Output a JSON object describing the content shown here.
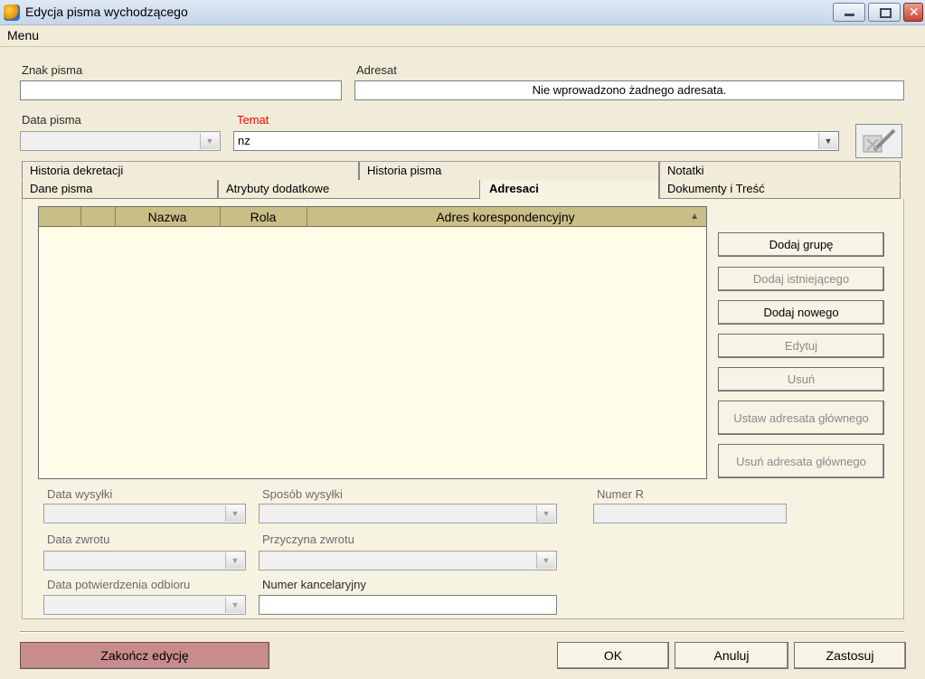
{
  "window": {
    "title": "Edycja pisma wychodzącego"
  },
  "menu": {
    "items": [
      "Menu"
    ]
  },
  "header": {
    "znak_label": "Znak pisma",
    "znak_value": "",
    "adresat_label": "Adresat",
    "adresat_value": "Nie wprowadzono żadnego adresata.",
    "data_label": "Data pisma",
    "data_value": "",
    "temat_label": "Temat",
    "temat_value": "nz"
  },
  "tabs": {
    "row1": [
      "Historia dekretacji",
      "Historia pisma",
      "Notatki"
    ],
    "row2": [
      "Dane pisma",
      "Atrybuty dodatkowe",
      "Adresaci",
      "Dokumenty i Treść"
    ],
    "active": "Adresaci"
  },
  "grid": {
    "columns": [
      "",
      "",
      "Nazwa",
      "Rola",
      "Adres korespondencyjny"
    ],
    "rows": []
  },
  "side_buttons": [
    {
      "label": "Dodaj grupę",
      "enabled": true
    },
    {
      "label": "Dodaj istniejącego",
      "enabled": false
    },
    {
      "label": "Dodaj nowego",
      "enabled": true
    },
    {
      "label": "Edytuj",
      "enabled": false
    },
    {
      "label": "Usuń",
      "enabled": false
    },
    {
      "label": "Ustaw adresata głównego",
      "enabled": false
    },
    {
      "label": "Usuń adresata głównego",
      "enabled": true
    }
  ],
  "fields": {
    "data_wysylki": "Data wysyłki",
    "sposob_wysylki": "Sposób wysyłki",
    "numer_r": "Numer R",
    "data_zwrotu": "Data zwrotu",
    "przyczyna_zwrotu": "Przyczyna zwrotu",
    "data_potwierdzenia": "Data potwierdzenia odbioru",
    "numer_kancelaryjny": "Numer kancelaryjny"
  },
  "footer": {
    "finish": "Zakończ edycję",
    "ok": "OK",
    "cancel": "Anuluj",
    "apply": "Zastosuj"
  },
  "colors": {
    "accent_header": "#c9be86",
    "finish_button": "#c98c8c",
    "required_label": "#ff0000"
  }
}
